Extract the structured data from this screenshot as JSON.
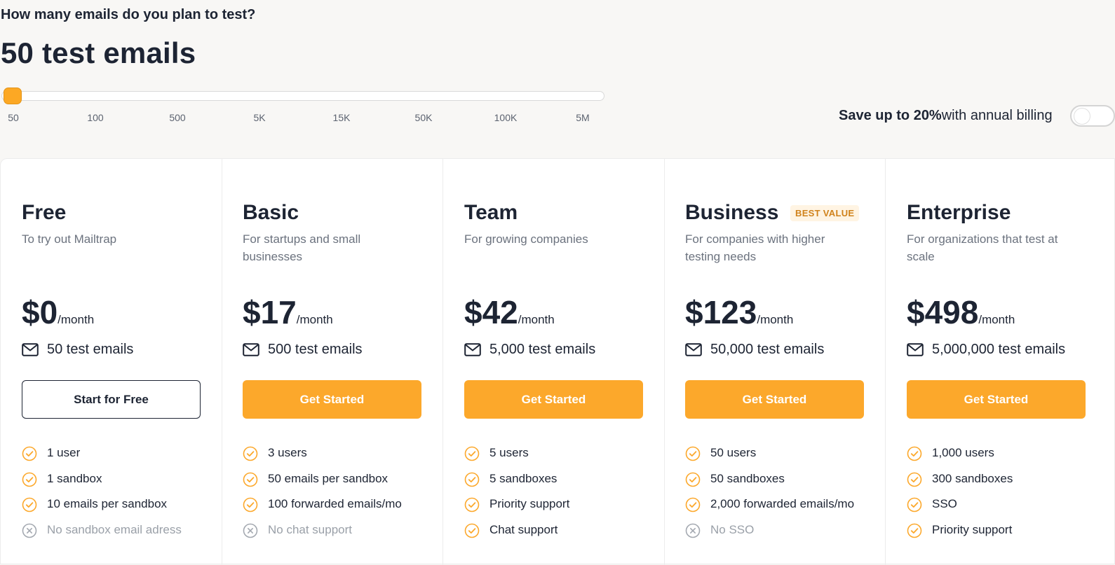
{
  "slider": {
    "question": "How many emails do you plan to test?",
    "selected": "50 test emails",
    "ticks": [
      "50",
      "100",
      "500",
      "5K",
      "15K",
      "50K",
      "100K",
      "5M"
    ]
  },
  "billing": {
    "save_text": "Save up to 20%",
    "rest_text": "with annual billing"
  },
  "colors": {
    "accent": "#fca82b",
    "text": "#1d2433",
    "muted": "#6b727e"
  },
  "plans": [
    {
      "name": "Free",
      "desc": "To try out Mailtrap",
      "price": "$0",
      "per": "/month",
      "emails": "50 test emails",
      "button": "Start for Free",
      "features": [
        {
          "text": "1 user",
          "ok": true
        },
        {
          "text": "1 sandbox",
          "ok": true
        },
        {
          "text": "10 emails per sandbox",
          "ok": true
        },
        {
          "text": "No sandbox email adress",
          "ok": false
        }
      ]
    },
    {
      "name": "Basic",
      "desc": "For startups and small businesses",
      "price": "$17",
      "per": "/month",
      "emails": "500 test emails",
      "button": "Get Started",
      "features": [
        {
          "text": "3 users",
          "ok": true
        },
        {
          "text": "50 emails per sandbox",
          "ok": true
        },
        {
          "text": "100 forwarded emails/mo",
          "ok": true
        },
        {
          "text": "No chat support",
          "ok": false
        }
      ]
    },
    {
      "name": "Team",
      "desc": "For growing companies",
      "price": "$42",
      "per": "/month",
      "emails": "5,000 test emails",
      "button": "Get Started",
      "features": [
        {
          "text": "5 users",
          "ok": true
        },
        {
          "text": "5 sandboxes",
          "ok": true
        },
        {
          "text": "Priority support",
          "ok": true
        },
        {
          "text": "Chat support",
          "ok": true
        }
      ]
    },
    {
      "name": "Business",
      "badge": "BEST VALUE",
      "desc": "For companies with higher testing needs",
      "price": "$123",
      "per": "/month",
      "emails": "50,000 test emails",
      "button": "Get Started",
      "features": [
        {
          "text": "50 users",
          "ok": true
        },
        {
          "text": "50 sandboxes",
          "ok": true
        },
        {
          "text": "2,000 forwarded emails/mo",
          "ok": true
        },
        {
          "text": "No SSO",
          "ok": false
        }
      ]
    },
    {
      "name": "Enterprise",
      "desc": "For organizations that test at scale",
      "price": "$498",
      "per": "/month",
      "emails": "5,000,000 test emails",
      "button": "Get Started",
      "features": [
        {
          "text": "1,000 users",
          "ok": true
        },
        {
          "text": "300 sandboxes",
          "ok": true
        },
        {
          "text": "SSO",
          "ok": true
        },
        {
          "text": "Priority support",
          "ok": true
        }
      ]
    }
  ]
}
